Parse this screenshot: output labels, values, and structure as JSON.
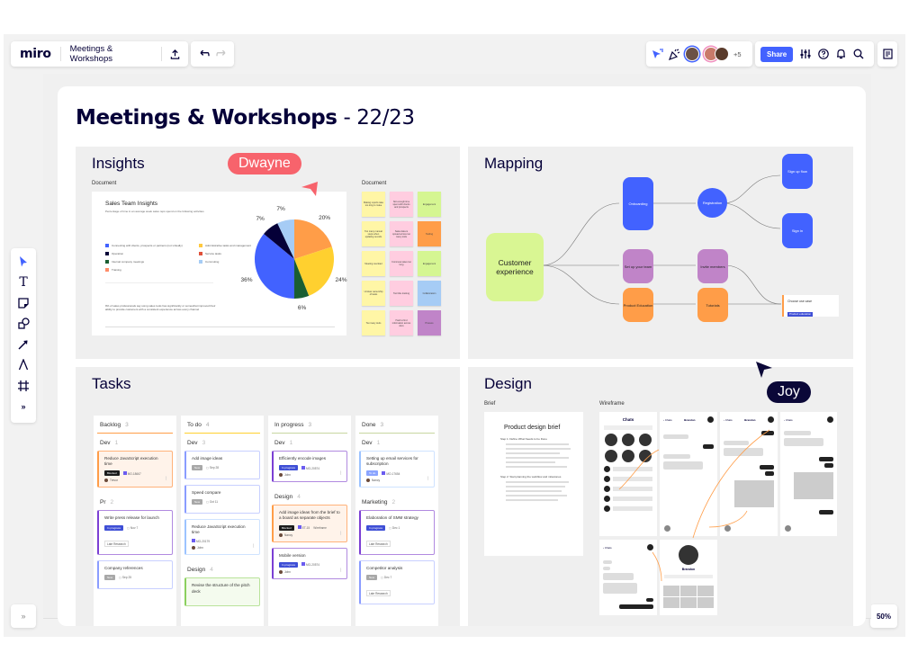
{
  "topbar": {
    "logo": "miro",
    "board_name": "Meetings & Workshops",
    "collaborator_extra": "+5",
    "share_label": "Share"
  },
  "zoom_level": "50%",
  "board": {
    "title_bold": "Meetings & Workshops",
    "title_light": " - 22/23"
  },
  "cursors": [
    {
      "name": "Dwayne",
      "color": "#f7636c"
    },
    {
      "name": "Joy",
      "color": "#0b0838"
    }
  ],
  "insights": {
    "title": "Insights",
    "doc_label": "Document",
    "stickies_label": "Document",
    "doc_title": "Sales Team Insights",
    "doc_sub": "Percentage of time in an average week sales reps spend on the following activities",
    "legend": [
      {
        "label": "Connecting with clients, prospects or partners (not virtually)",
        "color": "#4262ff"
      },
      {
        "label": "Administrative tasks and management",
        "color": "#ffc93f"
      },
      {
        "label": "Operation",
        "color": "#050038"
      },
      {
        "label": "Service tasks",
        "color": "#e0513a"
      },
      {
        "label": "Internal company meetings",
        "color": "#1a5e32"
      },
      {
        "label": "Commuting",
        "color": "#a6ccf5"
      },
      {
        "label": "Training",
        "color": "#ff8c69"
      }
    ],
    "doc_para": "9% of sales professionals say using sales tools has significantly or somewhat improved their ability to provide customers with a consistent experience across every channel",
    "chart": {
      "type": "pie",
      "slices": [
        {
          "label": "20%",
          "value": 20,
          "color": "#ff9d48"
        },
        {
          "label": "24%",
          "value": 24,
          "color": "#ffd02f"
        },
        {
          "label": "6%",
          "value": 6,
          "color": "#1a5e32"
        },
        {
          "label": "36%",
          "value": 36,
          "color": "#4262ff"
        },
        {
          "label": "7%",
          "value": 7,
          "color": "#050038"
        },
        {
          "label": "7%",
          "value": 7,
          "color": "#a6ccf5"
        }
      ]
    },
    "stickies": [
      {
        "text": "Making reports take too long to make",
        "color": "#fff6a6"
      },
      {
        "text": "Not enough time spent with clients and prospects",
        "color": "#ffcde0"
      },
      {
        "text": "Engagement",
        "color": "#d5f692"
      },
      {
        "text": "Too many manual steps when updating records",
        "color": "#fff6a6"
      },
      {
        "text": "Sales data is spread across too many tools",
        "color": "#ffcde0"
      },
      {
        "text": "Tooling",
        "color": "#ff9d48"
      },
      {
        "text": "Meeting overload",
        "color": "#fff6a6"
      },
      {
        "text": "Commute takes too long",
        "color": "#ffcde0"
      },
      {
        "text": "Engagement",
        "color": "#d5f692"
      },
      {
        "text": "Unclear ownership of tasks",
        "color": "#fff6a6"
      },
      {
        "text": "Too little training",
        "color": "#ffcde0"
      },
      {
        "text": "Collaboration",
        "color": "#a6ccf5"
      },
      {
        "text": "Too many tools",
        "color": "#fff6a6"
      },
      {
        "text": "Hard to find information across docs",
        "color": "#ffcde0"
      },
      {
        "text": "Process",
        "color": "#c084c8"
      }
    ]
  },
  "mapping": {
    "title": "Mapping",
    "nodes": {
      "customer": "Customer experience",
      "onboarding": "Onboarding",
      "registration": "Registration",
      "signup": "Sign up flow",
      "signin": "Sign in",
      "setup": "Set up your team",
      "invite": "Invite members",
      "education": "Product Education",
      "tutorials": "Tutorials",
      "card_title": "Choose use case",
      "card_tag": "Product education"
    }
  },
  "tasks": {
    "title": "Tasks",
    "columns": [
      {
        "name": "Backlog",
        "count": "3",
        "color": "#ff9d48",
        "groups": [
          {
            "name": "Dev",
            "count": "1",
            "cards": [
              {
                "title": "Reduce JavaScript execution time",
                "tag": "Blocked",
                "tag_color": "#1b1b1b",
                "id": "MO-18667",
                "person": "Trevor",
                "style": "orange"
              }
            ]
          },
          {
            "name": "Pr",
            "count": "2",
            "cards": [
              {
                "title": "Write press release for launch",
                "tag": "In progress",
                "tag_color": "#3f4fd6",
                "date": "Nov 7",
                "extra": "Late Research",
                "style": "purple"
              },
              {
                "title": "Company references",
                "tag": "New",
                "tag_color": "#a8a8a8",
                "date": "Sep 25",
                "style": "blue"
              }
            ]
          }
        ]
      },
      {
        "name": "To do",
        "count": "4",
        "color": "#ffd02f",
        "groups": [
          {
            "name": "Dev",
            "count": "3",
            "cards": [
              {
                "title": "Add image ideas",
                "tag": "New",
                "tag_color": "#a8a8a8",
                "date": "Sep 28",
                "style": "blue"
              },
              {
                "title": "Speed compare",
                "tag": "New",
                "tag_color": "#a8a8a8",
                "date": "Oct 11",
                "style": "blue"
              },
              {
                "title": "Reduce JavaScript execution time",
                "id": "MO-20179",
                "person": "John",
                "style": "lightblue"
              }
            ]
          },
          {
            "name": "Design",
            "count": "4",
            "cards": [
              {
                "title": "Revise the structure of the pitch deck",
                "style": "green"
              }
            ]
          }
        ]
      },
      {
        "name": "In progress",
        "count": "3",
        "color": "#c7d6a0",
        "groups": [
          {
            "name": "Dev",
            "count": "1",
            "cards": [
              {
                "title": "Efficiently encode images",
                "tag": "In progress",
                "tag_color": "#3f4fd6",
                "id": "MO-20574",
                "person": "John",
                "style": "purple"
              }
            ]
          },
          {
            "name": "Design",
            "count": "4",
            "cards": [
              {
                "title": "Add image ideas from the brief to a board as separate objects",
                "tag": "Blocked",
                "tag_color": "#1b1b1b",
                "id": "ET-15",
                "extra": "Wireframe",
                "person": "Nancy",
                "style": "orange"
              },
              {
                "title": "Mobile version",
                "tag": "In progress",
                "tag_color": "#3f4fd6",
                "id": "MO-20574",
                "person": "John",
                "style": "purple"
              }
            ]
          }
        ]
      },
      {
        "name": "Done",
        "count": "3",
        "color": "#c7d6a0",
        "groups": [
          {
            "name": "Dev",
            "count": "1",
            "cards": [
              {
                "title": "Setting up email services for subscription",
                "tag": "To do",
                "tag_color": "#8aa4ff",
                "id": "MO-17654",
                "person": "Nancy",
                "style": "lightblue"
              }
            ]
          },
          {
            "name": "Marketing",
            "count": "2",
            "cards": [
              {
                "title": "Elaboration of SMM strategy",
                "tag": "In progress",
                "tag_color": "#3f4fd6",
                "date": "Dec 1",
                "extra": "Late Research",
                "style": "purple"
              },
              {
                "title": "Competitor analysis",
                "tag": "New",
                "tag_color": "#a8a8a8",
                "date": "Dec 7",
                "extra": "Late Research",
                "style": "blue"
              }
            ]
          }
        ]
      }
    ]
  },
  "design": {
    "title": "Design",
    "brief_label": "Brief",
    "wireframe_label": "Wireframe",
    "brief_title": "Product design brief",
    "brief_step1": "Step 1: Define What Needs to be Done",
    "brief_step2": "Step 2: Start planning the workflow and milestones",
    "wf_chats": "Chats",
    "wf_contact1": "Brandon",
    "wf_contact2": "Brandon",
    "wf_profile": "Brandon"
  },
  "toolbar_tools": [
    "select",
    "text",
    "sticky-note",
    "shapes",
    "arrow",
    "pen",
    "frame",
    "more"
  ]
}
